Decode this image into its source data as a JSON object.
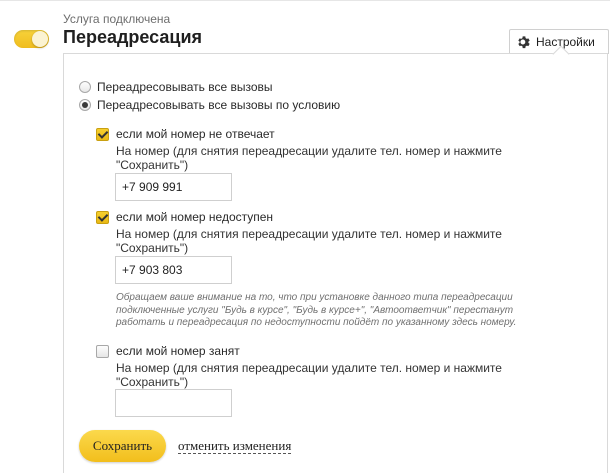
{
  "service": {
    "status": "Услуга подключена",
    "title": "Переадресация",
    "enabled": true
  },
  "settings_button": {
    "label": "Настройки",
    "icon": "gear-icon"
  },
  "options": {
    "all_calls": {
      "label": "Переадресовывать все вызовы",
      "selected": false
    },
    "conditional": {
      "label": "Переадресовывать все вызовы по условию",
      "selected": true
    }
  },
  "conditions": {
    "no_answer": {
      "label": "если мой номер не отвечает",
      "checked": true,
      "hint": "На номер (для снятия переадресации удалите тел. номер и нажмите \"Сохранить\")",
      "value": "+7 909 991"
    },
    "unavailable": {
      "label": "если мой номер недоступен",
      "checked": true,
      "hint": "На номер (для снятия переадресации удалите тел. номер и нажмите \"Сохранить\")",
      "value": "+7 903 803"
    },
    "notice": "Обращаем ваше внимание на то, что при установке данного типа переадресации подключенные услуги \"Будь в курсе\", \"Будь в курсе+\", \"Автоответчик\" перестанут работать и переадресация по недоступности пойдёт по указанному здесь номеру.",
    "busy": {
      "label": "если мой номер занят",
      "checked": false,
      "hint": "На номер (для снятия переадресации удалите тел. номер и нажмите \"Сохранить\")",
      "value": ""
    }
  },
  "actions": {
    "save_label": "Сохранить",
    "cancel_label": "отменить изменения"
  },
  "colors": {
    "accent": "#f2be1c",
    "border": "#d9d9d9"
  }
}
